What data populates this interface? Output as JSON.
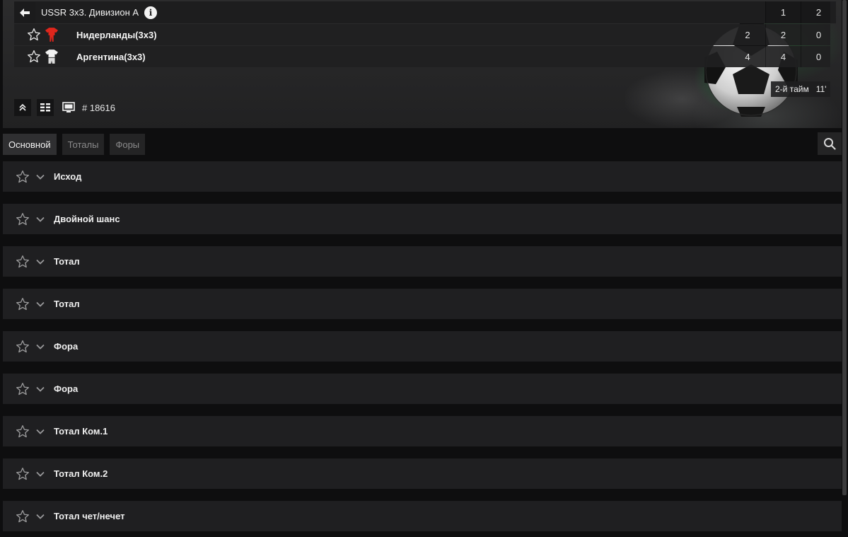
{
  "header": {
    "league_title": "USSR 3x3. Дивизион А",
    "info_icon": "info-icon",
    "back_icon": "arrow-left-icon",
    "score_header": [
      "",
      "1",
      "2"
    ],
    "teams": [
      {
        "name": "Нидерланды(3x3)",
        "kit_color": "#e0261c",
        "scores": [
          "2",
          "2",
          "0"
        ]
      },
      {
        "name": "Аргентина(3x3)",
        "kit_color": "#f2f2f2",
        "scores": [
          "4",
          "4",
          "0"
        ]
      }
    ],
    "period": "2-й тайм",
    "minute": "11'",
    "match_id": "# 18616"
  },
  "tabs": [
    {
      "label": "Основной",
      "active": true
    },
    {
      "label": "Тоталы",
      "active": false
    },
    {
      "label": "Форы",
      "active": false
    }
  ],
  "markets": [
    {
      "label": "Исход"
    },
    {
      "label": "Двойной шанс"
    },
    {
      "label": "Тотал"
    },
    {
      "label": "Тотал"
    },
    {
      "label": "Фора"
    },
    {
      "label": "Фора"
    },
    {
      "label": "Тотал Ком.1"
    },
    {
      "label": "Тотал Ком.2"
    },
    {
      "label": "Тотал чет/нечет"
    }
  ],
  "colors": {
    "background": "#0e0e0f",
    "panel": "#1f1f21",
    "accent_green": "#239646"
  }
}
